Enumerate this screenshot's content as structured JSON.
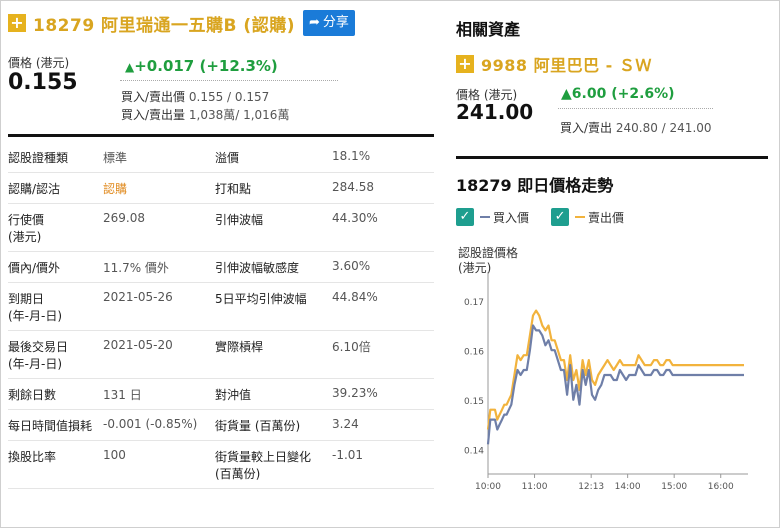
{
  "warrant": {
    "code_name": "18279 阿里瑞通一五購B (認購)",
    "share_label": "分享",
    "price_label": "價格 (港元)",
    "price": "0.155",
    "change": "+0.017 (+12.3%)",
    "bid_ask_label": "買入/賣出價",
    "bid_ask": "0.155 / 0.157",
    "bid_ask_vol_label": "買入/賣出量",
    "bid_ask_vol": "1,038萬/ 1,016萬"
  },
  "info_rows": [
    [
      "認股證種類",
      "標準",
      "溢價",
      "18.1%"
    ],
    [
      "認購/認沽",
      "認購",
      "打和點",
      "284.58"
    ],
    [
      "行使價\n(港元)",
      "269.08",
      "引伸波幅",
      "44.30%"
    ],
    [
      "價內/價外",
      "11.7% 價外",
      "引伸波幅敏感度",
      "3.60%"
    ],
    [
      "到期日\n(年-月-日)",
      "2021-05-26",
      "5日平均引伸波幅",
      "44.84%"
    ],
    [
      "最後交易日\n(年-月-日)",
      "2021-05-20",
      "實際槓桿",
      "6.10倍"
    ],
    [
      "剩餘日數",
      "131 日",
      "對沖值",
      "39.23%"
    ],
    [
      "每日時間值損耗",
      "-0.001 (-0.85%)",
      "街貨量 (百萬份)",
      "3.24"
    ],
    [
      "換股比率",
      "100",
      "街貨量較上日變化\n(百萬份)",
      "-1.01"
    ]
  ],
  "related": {
    "heading": "相關資產",
    "code_name": "9988 阿里巴巴 - ＳＷ",
    "price_label": "價格 (港元)",
    "price": "241.00",
    "change": "6.00 (+2.6%)",
    "bid_ask_label": "買入/賣出",
    "bid_ask": "240.80 / 241.00"
  },
  "chart_title": "18279 即日價格走勢",
  "legend": {
    "bid": "買入價",
    "ask": "賣出價"
  },
  "colors": {
    "bid": "#6f7fa8",
    "ask": "#f2b33d",
    "up": "#1f9e3f",
    "brand": "#d9a520",
    "check": "#1e9e8f"
  },
  "icons": {
    "plus": "plus-icon",
    "share": "share-arrow-icon",
    "check": "check-icon",
    "up": "triangle-up-icon"
  },
  "chart_data": {
    "type": "line",
    "ylabel": "認股證價格\n(港元)",
    "ylim": [
      0.135,
      0.175
    ],
    "yticks": [
      "0.17",
      "0.16",
      "0.15",
      "0.14"
    ],
    "yticks_vals": [
      0.17,
      0.16,
      0.15,
      0.14
    ],
    "xticks": [
      "10:00",
      "11:00",
      "12:13",
      "14:00",
      "15:00",
      "16:00"
    ],
    "xticks_vals": [
      0,
      60,
      133,
      180,
      240,
      300
    ],
    "x_minutes_since": "09:30",
    "series": [
      {
        "name": "買入價",
        "x": [
          0,
          3,
          6,
          9,
          12,
          15,
          18,
          21,
          24,
          27,
          30,
          34,
          38,
          42,
          46,
          50,
          54,
          58,
          62,
          66,
          70,
          74,
          78,
          82,
          86,
          90,
          94,
          98,
          102,
          106,
          110,
          114,
          118,
          122,
          126,
          130,
          134,
          138,
          142,
          146,
          150,
          154,
          158,
          162,
          166,
          170,
          174,
          178,
          182,
          186,
          190,
          194,
          198,
          202,
          206,
          210,
          214,
          218,
          222,
          226,
          230,
          234,
          238,
          242,
          246,
          250,
          254,
          258,
          262,
          266,
          270,
          280,
          290,
          300,
          310,
          320,
          330
        ],
        "values": [
          0.141,
          0.146,
          0.146,
          0.146,
          0.144,
          0.145,
          0.146,
          0.147,
          0.147,
          0.148,
          0.149,
          0.153,
          0.156,
          0.155,
          0.156,
          0.156,
          0.16,
          0.165,
          0.164,
          0.164,
          0.163,
          0.161,
          0.162,
          0.16,
          0.16,
          0.158,
          0.156,
          0.156,
          0.151,
          0.157,
          0.15,
          0.153,
          0.149,
          0.156,
          0.153,
          0.156,
          0.151,
          0.15,
          0.152,
          0.153,
          0.155,
          0.155,
          0.155,
          0.154,
          0.154,
          0.156,
          0.155,
          0.154,
          0.155,
          0.155,
          0.155,
          0.157,
          0.156,
          0.155,
          0.155,
          0.155,
          0.156,
          0.156,
          0.155,
          0.155,
          0.156,
          0.156,
          0.155,
          0.155,
          0.155,
          0.155,
          0.155,
          0.155,
          0.155,
          0.155,
          0.155,
          0.155,
          0.155,
          0.155,
          0.155,
          0.155,
          0.155
        ]
      },
      {
        "name": "賣出價",
        "x": [
          0,
          3,
          6,
          9,
          12,
          15,
          18,
          21,
          24,
          27,
          30,
          34,
          38,
          42,
          46,
          50,
          54,
          58,
          62,
          66,
          70,
          74,
          78,
          82,
          86,
          90,
          94,
          98,
          102,
          106,
          110,
          114,
          118,
          122,
          126,
          130,
          134,
          138,
          142,
          146,
          150,
          154,
          158,
          162,
          166,
          170,
          174,
          178,
          182,
          186,
          190,
          194,
          198,
          202,
          206,
          210,
          214,
          218,
          222,
          226,
          230,
          234,
          238,
          242,
          246,
          250,
          254,
          258,
          262,
          266,
          270,
          280,
          290,
          300,
          310,
          320,
          330
        ],
        "values": [
          0.144,
          0.148,
          0.148,
          0.148,
          0.146,
          0.147,
          0.148,
          0.149,
          0.149,
          0.15,
          0.151,
          0.155,
          0.159,
          0.158,
          0.159,
          0.159,
          0.163,
          0.167,
          0.168,
          0.167,
          0.165,
          0.164,
          0.165,
          0.162,
          0.162,
          0.16,
          0.158,
          0.158,
          0.154,
          0.159,
          0.154,
          0.156,
          0.152,
          0.158,
          0.155,
          0.158,
          0.154,
          0.153,
          0.155,
          0.156,
          0.157,
          0.158,
          0.157,
          0.156,
          0.157,
          0.158,
          0.157,
          0.157,
          0.157,
          0.157,
          0.157,
          0.159,
          0.158,
          0.157,
          0.157,
          0.157,
          0.158,
          0.158,
          0.157,
          0.157,
          0.158,
          0.158,
          0.157,
          0.157,
          0.157,
          0.157,
          0.157,
          0.157,
          0.157,
          0.157,
          0.157,
          0.157,
          0.157,
          0.157,
          0.157,
          0.157,
          0.157
        ]
      }
    ]
  }
}
